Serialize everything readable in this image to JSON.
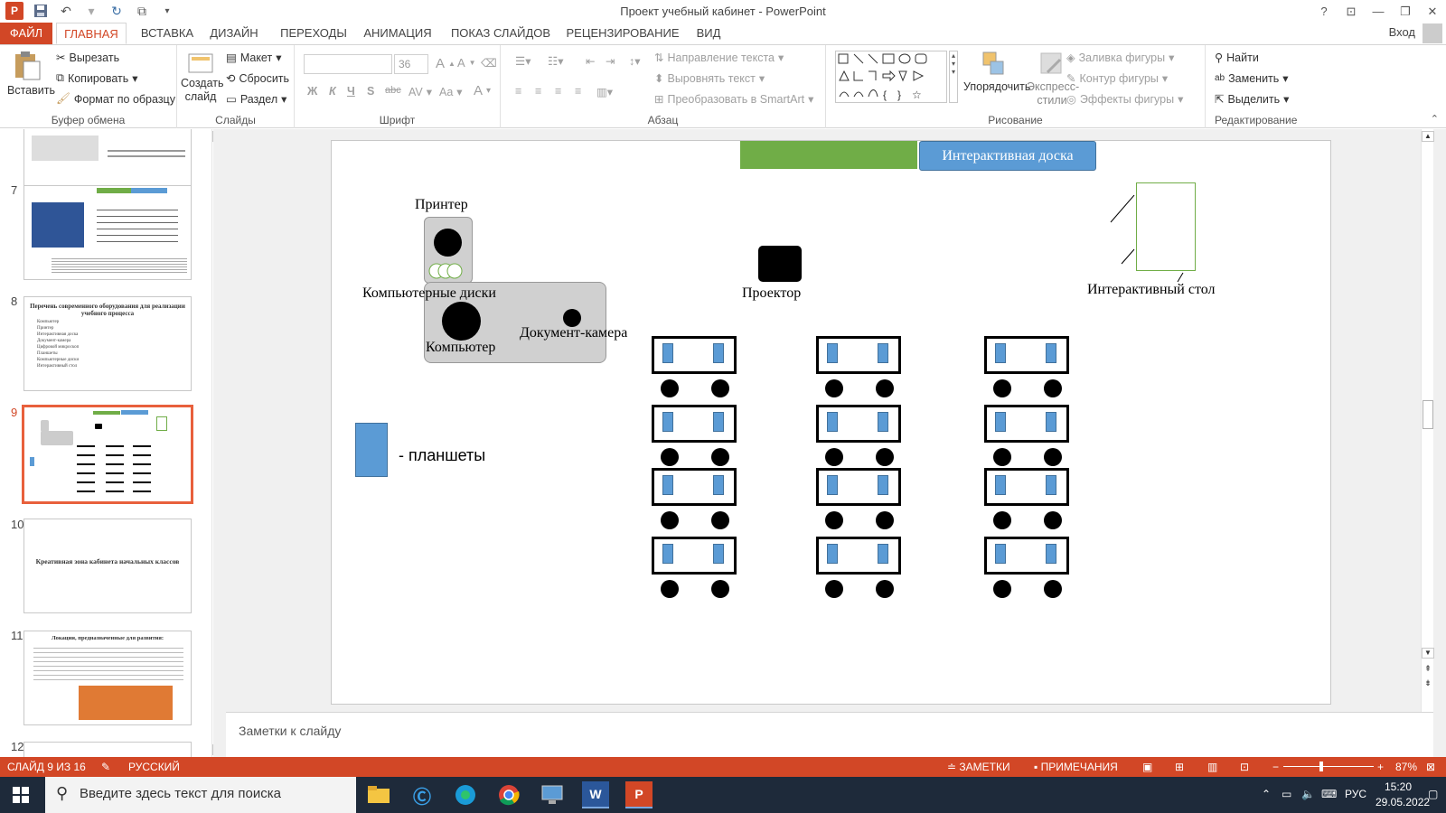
{
  "window": {
    "title": "Проект учебный кабинет - PowerPoint",
    "login": "Вход"
  },
  "colors": {
    "accent": "#d24726",
    "green": "#70ad47",
    "blue": "#5b9bd5"
  },
  "tabs": [
    "ФАЙЛ",
    "ГЛАВНАЯ",
    "ВСТАВКА",
    "ДИЗАЙН",
    "ПЕРЕХОДЫ",
    "АНИМАЦИЯ",
    "ПОКАЗ СЛАЙДОВ",
    "РЕЦЕНЗИРОВАНИЕ",
    "ВИД"
  ],
  "ribbon": {
    "clipboard": {
      "paste": "Вставить",
      "cut": "Вырезать",
      "copy": "Копировать",
      "format": "Формат по образцу",
      "label": "Буфер обмена"
    },
    "slides": {
      "create": "Создать",
      "create2": "слайд",
      "layout": "Макет",
      "reset": "Сбросить",
      "section": "Раздел",
      "label": "Слайды"
    },
    "font": {
      "size": "36",
      "label": "Шрифт",
      "bold": "Ж",
      "italic": "К",
      "underline": "Ч",
      "shadow": "S",
      "strike": "abc",
      "spacing": "AV",
      "case": "Aa",
      "color": "A"
    },
    "paragraph": {
      "direction": "Направление текста",
      "align": "Выровнять текст",
      "smartart": "Преобразовать в SmartArt",
      "label": "Абзац"
    },
    "drawing": {
      "arrange": "Упорядочить",
      "styles": "Экспресс-",
      "styles2": "стили",
      "fill": "Заливка фигуры",
      "outline": "Контур фигуры",
      "effects": "Эффекты фигуры",
      "label": "Рисование"
    },
    "editing": {
      "find": "Найти",
      "replace": "Заменить",
      "select": "Выделить",
      "label": "Редактирование"
    }
  },
  "thumbnails": [
    {
      "num": "7"
    },
    {
      "num": "8",
      "title": "Перечень современного оборудования для реализации учебного процесса",
      "items": [
        "Компьютер",
        "Принтер",
        "Интерактивная доска",
        "Документ-камера",
        "Цифровой микроскоп",
        "Планшеты",
        "Компьютерные диски",
        "Интерактивный стол"
      ]
    },
    {
      "num": "9"
    },
    {
      "num": "10",
      "title": "Креативная зона кабинета начальных классов"
    },
    {
      "num": "11",
      "title": "Локации, предназначенные для развития:"
    },
    {
      "num": "12"
    }
  ],
  "slide": {
    "board": "Интерактивная доска",
    "printer": "Принтер",
    "discs": "Компьютерные диски",
    "computer": "Компьютер",
    "doccam": "Документ-камера",
    "projector": "Проектор",
    "table": "Интерактивный стол",
    "tablets": "- планшеты"
  },
  "notes": "Заметки к слайду",
  "status": {
    "slide": "СЛАЙД 9 ИЗ 16",
    "lang": "РУССКИЙ",
    "notes": "ЗАМЕТКИ",
    "comments": "ПРИМЕЧАНИЯ",
    "zoom": "87%"
  },
  "taskbar": {
    "search": "Введите здесь текст для поиска",
    "lang": "РУС",
    "time": "15:20",
    "date": "29.05.2022"
  }
}
